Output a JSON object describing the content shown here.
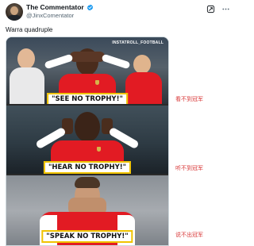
{
  "author": {
    "display_name": "The Commentator",
    "handle": "@JinxComentator",
    "verified": true
  },
  "icons": [
    "verified-badge-icon",
    "grok-icon",
    "more-options-icon"
  ],
  "tweet": {
    "text": "Warra quadruple"
  },
  "media": {
    "watermark": "INSTATROLL_FOOTBALL",
    "panels": [
      {
        "caption": "\"SEE NO TROPHY!\"",
        "side_note": "看不到冠军"
      },
      {
        "caption": "\"HEAR NO TROPHY!\"",
        "side_note": "听不到冠军"
      },
      {
        "caption": "\"SPEAK NO TROPHY!\"",
        "side_note": "说不出冠军"
      }
    ]
  },
  "colors": {
    "verified": "#1d9bf0",
    "handle": "#536471",
    "caption_border": "#f0c300",
    "side_note": "#d93a3a",
    "jersey": "#e21b23"
  }
}
